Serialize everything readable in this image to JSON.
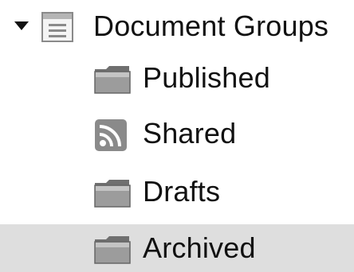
{
  "tree": {
    "root": {
      "label": "Document Groups",
      "expanded": true,
      "icon": "document-list-icon"
    },
    "items": [
      {
        "label": "Published",
        "icon": "folder-icon",
        "selected": false
      },
      {
        "label": "Shared",
        "icon": "rss-feed-icon",
        "selected": false
      },
      {
        "label": "Drafts",
        "icon": "folder-icon",
        "selected": false
      },
      {
        "label": "Archived",
        "icon": "folder-icon",
        "selected": true
      }
    ]
  },
  "colors": {
    "selection_background": "#dedede",
    "icon_gray": "#8a8a8a"
  }
}
